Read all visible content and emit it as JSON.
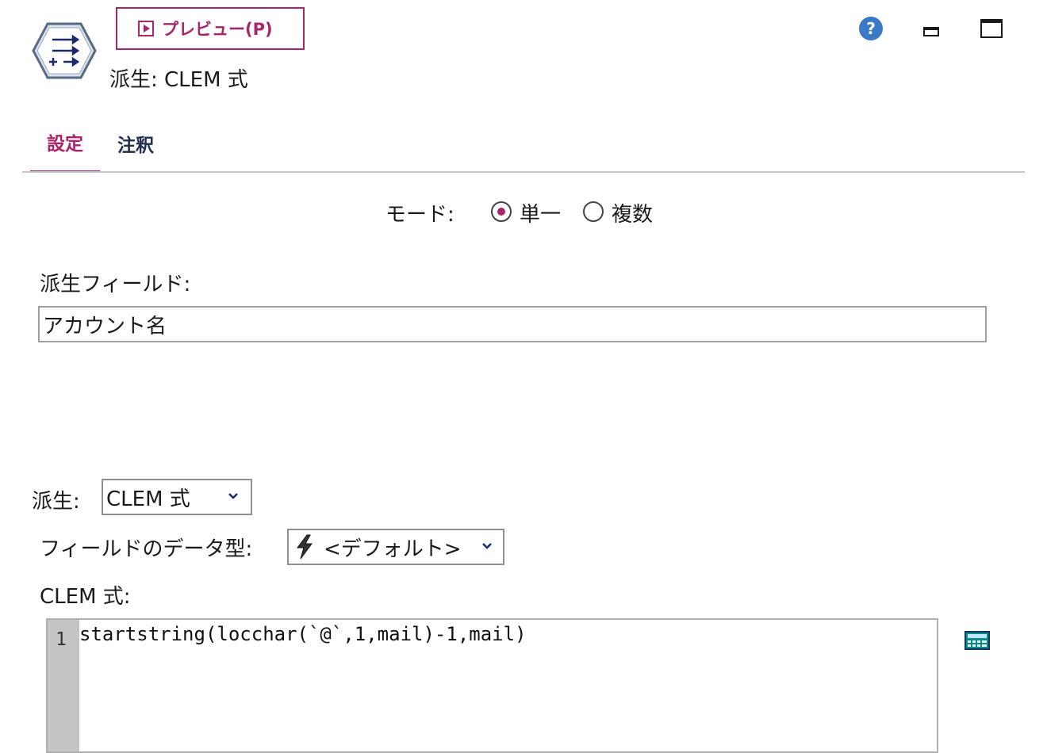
{
  "header": {
    "preview_label": "プレビュー(P)",
    "node_title": "派生: CLEM 式"
  },
  "tabs": [
    {
      "label": "設定",
      "active": true
    },
    {
      "label": "注釈",
      "active": false
    }
  ],
  "mode": {
    "label": "モード:",
    "options": [
      {
        "label": "単一",
        "selected": true
      },
      {
        "label": "複数",
        "selected": false
      }
    ]
  },
  "derive_field": {
    "label": "派生フィールド:",
    "value": "アカウント名"
  },
  "derive_as": {
    "label": "派生:",
    "value": "CLEM 式"
  },
  "field_type": {
    "label": "フィールドのデータ型:",
    "value": "<デフォルト>",
    "icon": "lightning-icon"
  },
  "expression": {
    "label": "CLEM 式:",
    "line_number": "1",
    "code": "startstring(locchar(`@`,1,mail)-1,mail)"
  },
  "colors": {
    "accent": "#a8246b",
    "tab_inactive": "#1f2f4f",
    "help_blue": "#3a78c8"
  }
}
